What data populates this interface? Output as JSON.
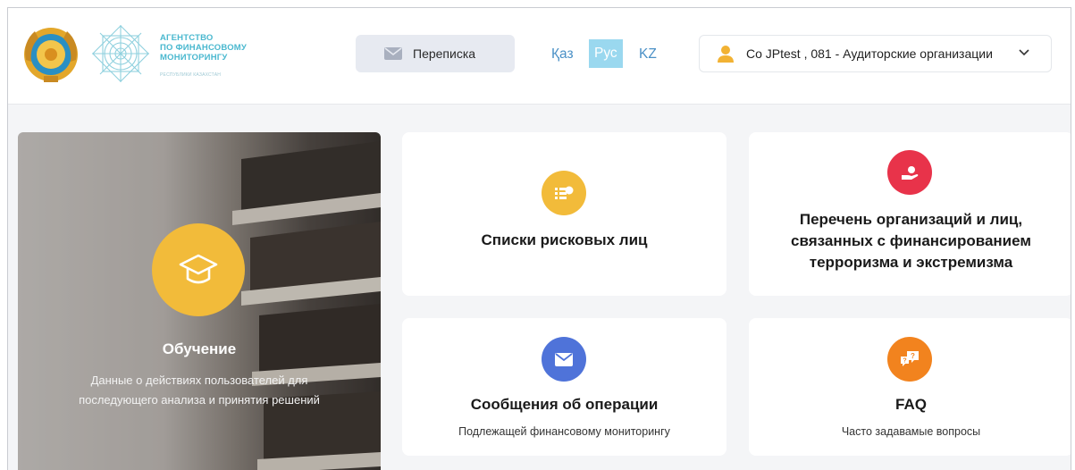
{
  "header": {
    "agency_name": "АГЕНТСТВО\nПО ФИНАНСОВОМУ\nМОНИТОРИНГУ",
    "agency_sub": "РЕСПУБЛИКИ КАЗАХСТАН",
    "messages_button": "Переписка",
    "languages": [
      {
        "label": "Қаз",
        "active": false
      },
      {
        "label": "Рус",
        "active": true
      },
      {
        "label": "KZ",
        "active": false
      }
    ],
    "user_select": "Со JPtest , 081 - Аудиторские организации",
    "colors": {
      "accent": "#4ab8cf",
      "lang_active_bg": "#9ad8ef",
      "person_icon": "#f2b233"
    }
  },
  "education": {
    "title": "Обучение",
    "description": "Данные о действиях пользователей для последующего анализа и принятия решений",
    "icon": "graduation-cap-icon",
    "color": "#f2bb3a"
  },
  "cards": {
    "risk_lists": {
      "title": "Списки рисковых лиц",
      "icon": "list-icon",
      "color": "#f2bb3a"
    },
    "terror_list": {
      "title": "Перечень организаций и лиц,\nсвязанных с финансированием\nтерроризма и экстремизма",
      "icon": "hand-money-icon",
      "color": "#e8334a"
    },
    "operations": {
      "title": "Сообщения об операции",
      "subtitle": "Подлежащей финансовому мониторингу",
      "icon": "envelope-icon",
      "color": "#4f73d9"
    },
    "faq": {
      "title": "FAQ",
      "subtitle": "Часто задавамые вопросы",
      "icon": "chat-question-icon",
      "color": "#f2831e"
    }
  }
}
